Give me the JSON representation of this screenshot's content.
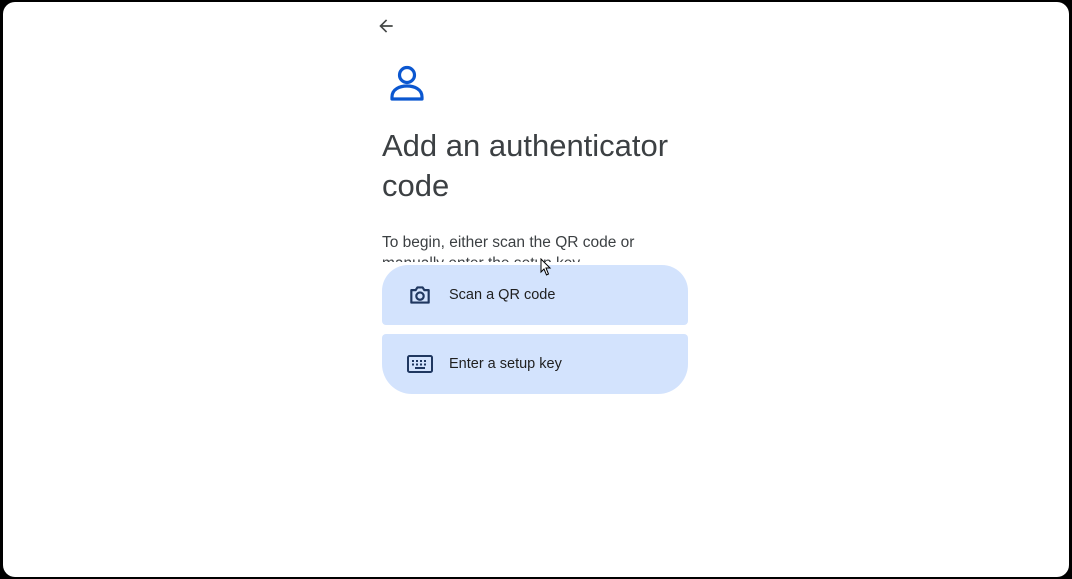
{
  "header": {
    "back_icon": "arrow-left-icon"
  },
  "hero": {
    "icon": "person-icon",
    "accent_color": "#0b57d0"
  },
  "title_line1": "Add an authenticator",
  "title_line2": "code",
  "description": "To begin, either scan the QR code or manually enter the setup key",
  "options": [
    {
      "icon": "camera-icon",
      "label": "Scan a QR code"
    },
    {
      "icon": "keyboard-icon",
      "label": "Enter a setup key"
    }
  ],
  "colors": {
    "option_bg": "#d3e3fd",
    "text": "#3c4043",
    "icon": "#1f3760"
  }
}
